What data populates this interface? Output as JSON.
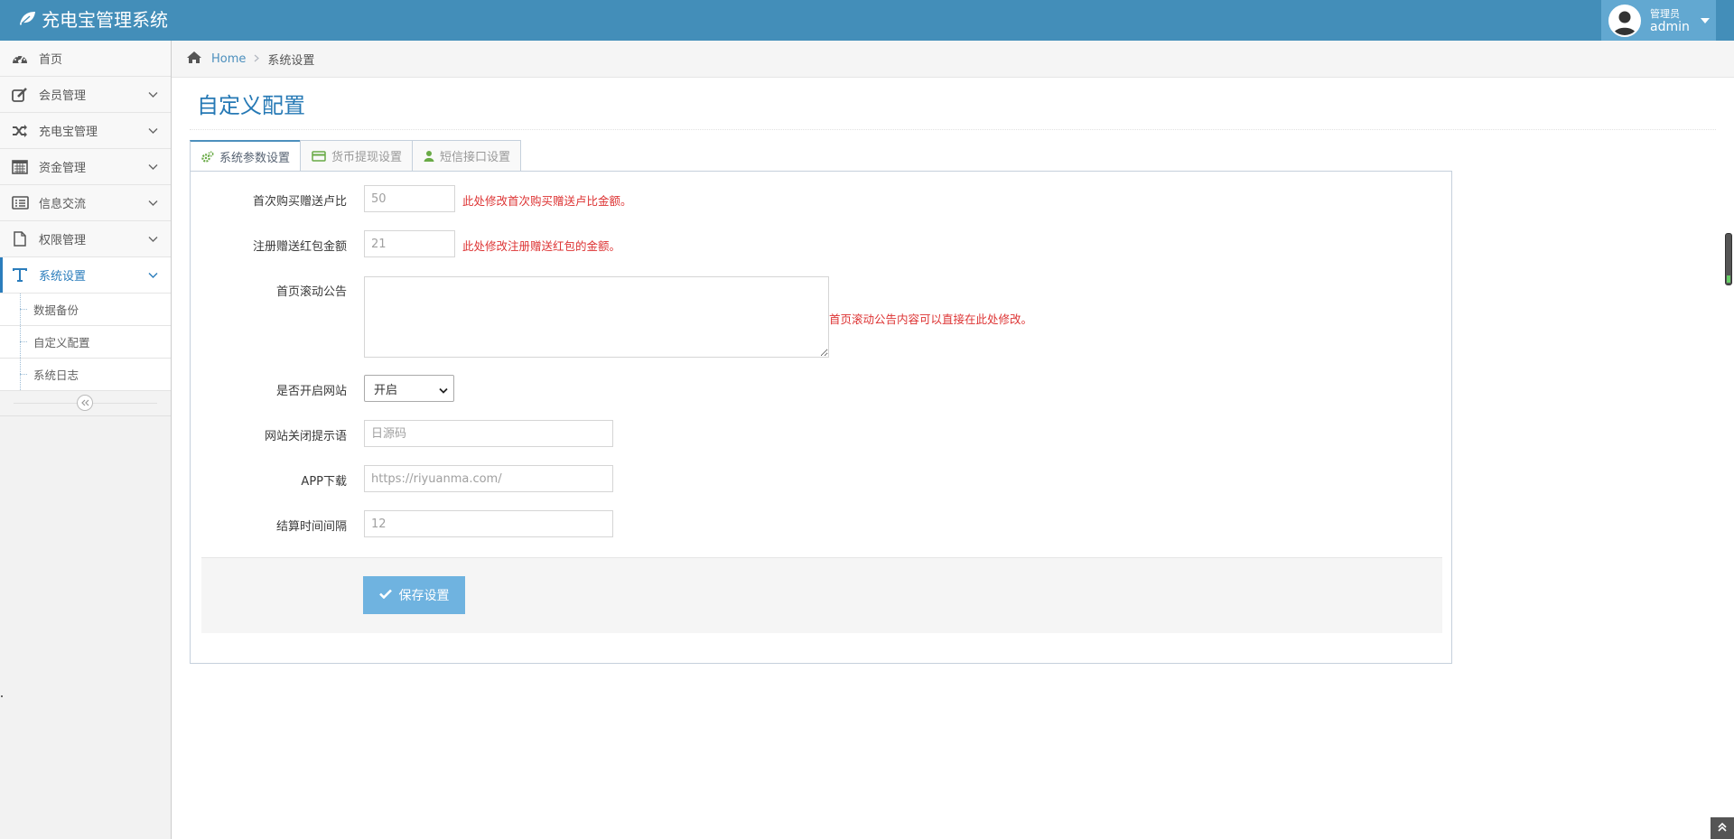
{
  "navbar": {
    "brand": "充电宝管理系统",
    "user_role": "管理员",
    "user_name": "admin"
  },
  "sidebar": {
    "items": [
      {
        "label": "首页",
        "icon": "dashboard-icon",
        "has_arrow": false
      },
      {
        "label": "会员管理",
        "icon": "edit-icon",
        "has_arrow": true
      },
      {
        "label": "充电宝管理",
        "icon": "shuffle-icon",
        "has_arrow": true
      },
      {
        "label": "资金管理",
        "icon": "calendar-icon",
        "has_arrow": true
      },
      {
        "label": "信息交流",
        "icon": "list-alt-icon",
        "has_arrow": true
      },
      {
        "label": "权限管理",
        "icon": "file-icon",
        "has_arrow": true
      },
      {
        "label": "系统设置",
        "icon": "text-icon",
        "has_arrow": true
      }
    ],
    "sub_items": [
      {
        "label": "数据备份"
      },
      {
        "label": "自定义配置"
      },
      {
        "label": "系统日志"
      }
    ]
  },
  "breadcrumb": {
    "home": "Home",
    "current": "系统设置"
  },
  "page": {
    "title": "自定义配置"
  },
  "tabs": [
    {
      "label": "系统参数设置",
      "icon": "cogs-icon",
      "active": true
    },
    {
      "label": "货币提现设置",
      "icon": "credit-card-icon",
      "active": false
    },
    {
      "label": "短信接口设置",
      "icon": "user-icon",
      "active": false
    }
  ],
  "form": {
    "first_purchase": {
      "label": "首次购买赠送卢比",
      "placeholder": "50",
      "help": "此处修改首次购买赠送卢比金额。"
    },
    "register_bonus": {
      "label": "注册赠送红包金额",
      "placeholder": "21",
      "help": "此处修改注册赠送红包的金额。"
    },
    "notice": {
      "label": "首页滚动公告",
      "value": "",
      "help": "首页滚动公告内容可以直接在此处修改。"
    },
    "site_open": {
      "label": "是否开启网站",
      "selected": "开启"
    },
    "close_tip": {
      "label": "网站关闭提示语",
      "placeholder": "日源码"
    },
    "app_download": {
      "label": "APP下载",
      "placeholder": "https://riyuanma.com/"
    },
    "settle_interval": {
      "label": "结算时间间隔",
      "placeholder": "12"
    },
    "save_label": "保存设置"
  },
  "colors": {
    "navbar": "#438eb9",
    "accent": "#2b7dbc",
    "help_text": "#dd3333",
    "save_button": "#6fb3e0"
  }
}
